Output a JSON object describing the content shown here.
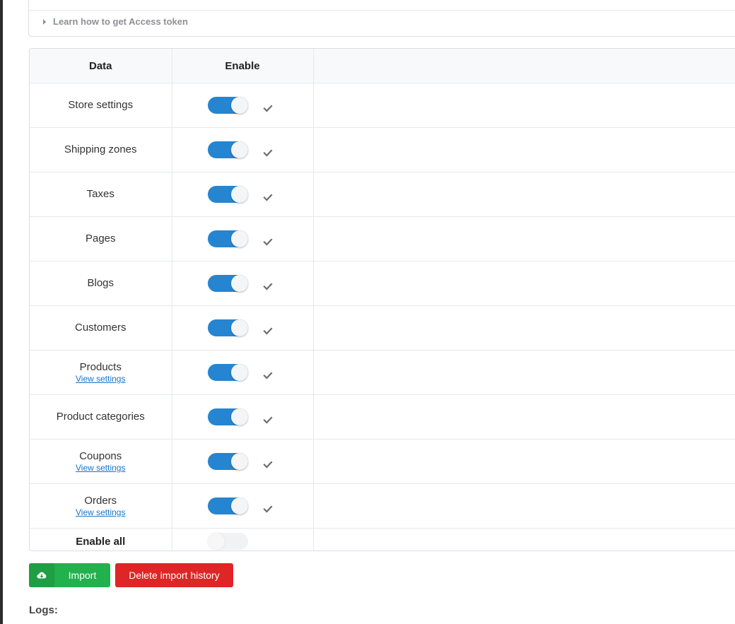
{
  "help": {
    "learn_link": "Learn how to get Access token"
  },
  "table": {
    "headers": {
      "data": "Data",
      "enable": "Enable",
      "extra": ""
    },
    "rows": [
      {
        "label": "Store settings",
        "enabled": true,
        "status": "done",
        "link": ""
      },
      {
        "label": "Shipping zones",
        "enabled": true,
        "status": "done",
        "link": ""
      },
      {
        "label": "Taxes",
        "enabled": true,
        "status": "done",
        "link": ""
      },
      {
        "label": "Pages",
        "enabled": true,
        "status": "done",
        "link": ""
      },
      {
        "label": "Blogs",
        "enabled": true,
        "status": "done",
        "link": ""
      },
      {
        "label": "Customers",
        "enabled": true,
        "status": "done",
        "link": ""
      },
      {
        "label": "Products",
        "enabled": true,
        "status": "done",
        "link": "View settings"
      },
      {
        "label": "Product categories",
        "enabled": true,
        "status": "done",
        "link": ""
      },
      {
        "label": "Coupons",
        "enabled": true,
        "status": "done",
        "link": "View settings"
      },
      {
        "label": "Orders",
        "enabled": true,
        "status": "done",
        "link": "View settings"
      }
    ],
    "enable_all": {
      "label": "Enable all",
      "enabled": false
    }
  },
  "actions": {
    "import_label": "Import",
    "import_icon": "cloud-download-icon",
    "delete_label": "Delete import history"
  },
  "logs": {
    "label": "Logs:"
  },
  "colors": {
    "toggle_on": "#2585d0",
    "import_btn": "#22b14c",
    "delete_btn": "#df2525",
    "link": "#1a73c9"
  }
}
